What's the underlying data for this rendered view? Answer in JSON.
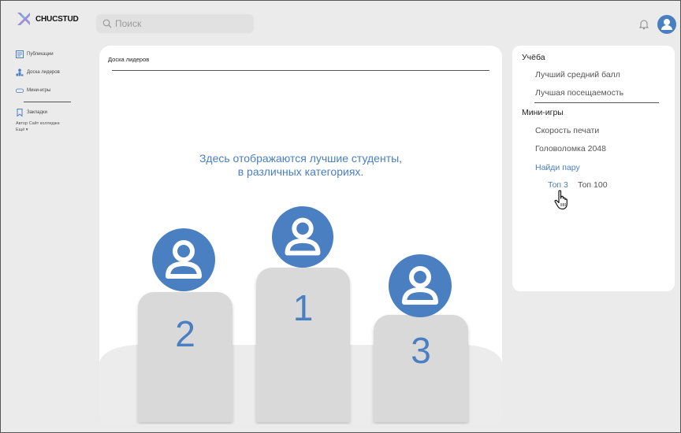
{
  "app": {
    "logo_text": "CHUCSTUD"
  },
  "search": {
    "placeholder": "Поиск"
  },
  "sidebar": {
    "items": [
      {
        "label": "Публикации",
        "icon": "publications-icon"
      },
      {
        "label": "Доска лидеров",
        "icon": "leaderboard-icon"
      },
      {
        "label": "Мини-игры",
        "icon": "gamepad-icon"
      },
      {
        "label": "Закладки",
        "icon": "bookmark-icon"
      }
    ],
    "footer_author": "Автор",
    "footer_site": "Сайт колледжа",
    "footer_more": "Ещё ▾"
  },
  "main": {
    "title": "Доска лидеров",
    "message_line1": "Здесь отображаются лучшие студенты,",
    "message_line2": "в различных категориях.",
    "podium": {
      "first": "1",
      "second": "2",
      "third": "3"
    }
  },
  "right": {
    "study_heading": "Учёба",
    "study_items": [
      "Лучший средний балл",
      "Лучшая посещаемость"
    ],
    "games_heading": "Мини-игры",
    "game_items": [
      "Скорость печати",
      "Головоломка 2048",
      "Найди пару"
    ],
    "sub_tabs": [
      "Топ 3",
      "Топ 100"
    ]
  },
  "colors": {
    "accent": "#4a7fc2",
    "background": "#ebebeb",
    "card": "#ffffff",
    "pedestal": "#d9d9d9"
  }
}
